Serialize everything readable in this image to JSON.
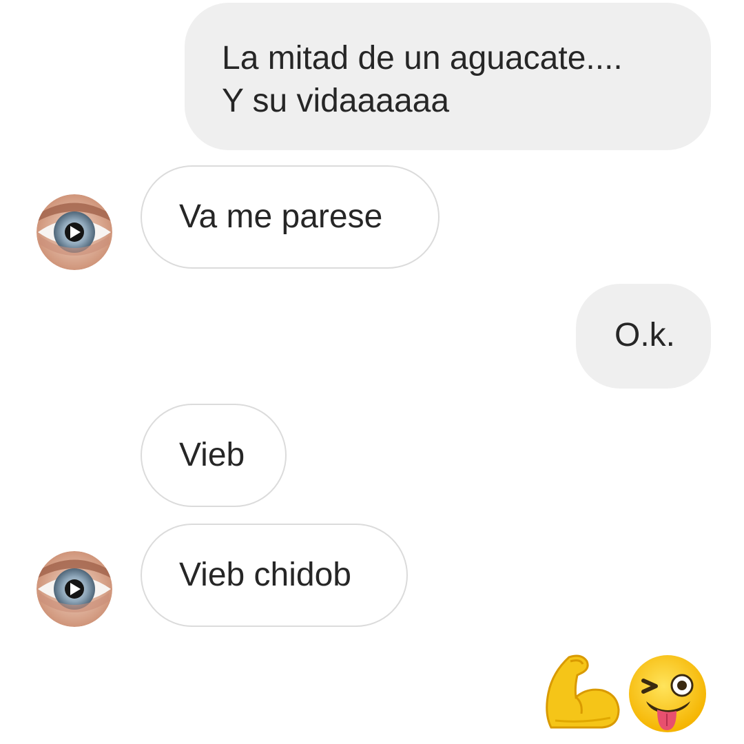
{
  "conversation": {
    "messages": [
      {
        "side": "sent",
        "text": "La mitad de un aguacate....\nY su vidaaaaaa"
      },
      {
        "side": "received",
        "text": "Va me parese"
      },
      {
        "side": "sent",
        "text": "O.k."
      },
      {
        "side": "received",
        "text": "Vieb"
      },
      {
        "side": "received",
        "text": "Vieb chidob"
      }
    ],
    "reactions": [
      "flexed-biceps-emoji",
      "winking-face-with-tongue-emoji"
    ]
  },
  "colors": {
    "sent_bubble": "#efefef",
    "received_border": "#dbdbdb",
    "text": "#262626",
    "background": "#ffffff"
  }
}
